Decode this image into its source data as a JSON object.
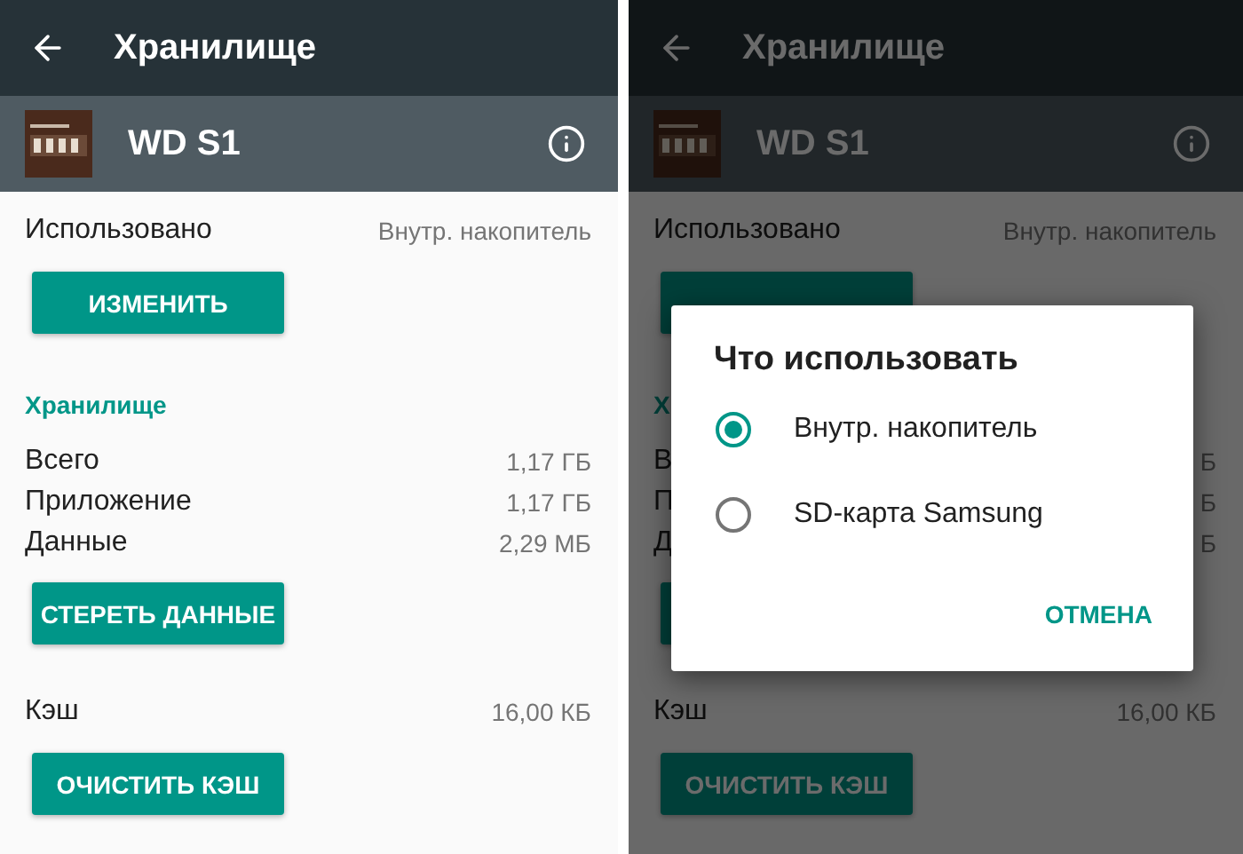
{
  "screens": [
    {
      "dimmed": false,
      "header": {
        "title": "Хранилище"
      },
      "app": {
        "name": "WD S1"
      },
      "used": {
        "label": "Использовано",
        "value": "Внутр. накопитель"
      },
      "change_button": "ИЗМЕНИТЬ",
      "section_title": "Хранилище",
      "rows": [
        {
          "label": "Всего",
          "value": "1,17 ГБ"
        },
        {
          "label": "Приложение",
          "value": "1,17 ГБ"
        },
        {
          "label": "Данные",
          "value": "2,29 МБ"
        }
      ],
      "clear_data_button": "СТЕРЕТЬ ДАННЫЕ",
      "cache": {
        "label": "Кэш",
        "value": "16,00 КБ"
      },
      "clear_cache_button": "ОЧИСТИТЬ КЭШ"
    },
    {
      "dimmed": true,
      "header": {
        "title": "Хранилище"
      },
      "app": {
        "name": "WD S1"
      },
      "used": {
        "label": "Использовано",
        "value": "Внутр. накопитель"
      },
      "section_title": "Х",
      "rows": [
        {
          "label": "В",
          "value": "Б"
        },
        {
          "label": "П",
          "value": "Б"
        },
        {
          "label": "Д",
          "value": "Б"
        }
      ],
      "cache": {
        "label": "Кэш",
        "value": "16,00 КБ"
      },
      "clear_cache_button": "ОЧИСТИТЬ КЭШ",
      "dialog": {
        "title": "Что использовать",
        "options": [
          {
            "label": "Внутр. накопитель",
            "selected": true
          },
          {
            "label": "SD-карта Samsung",
            "selected": false
          }
        ],
        "cancel": "ОТМЕНА"
      }
    }
  ]
}
